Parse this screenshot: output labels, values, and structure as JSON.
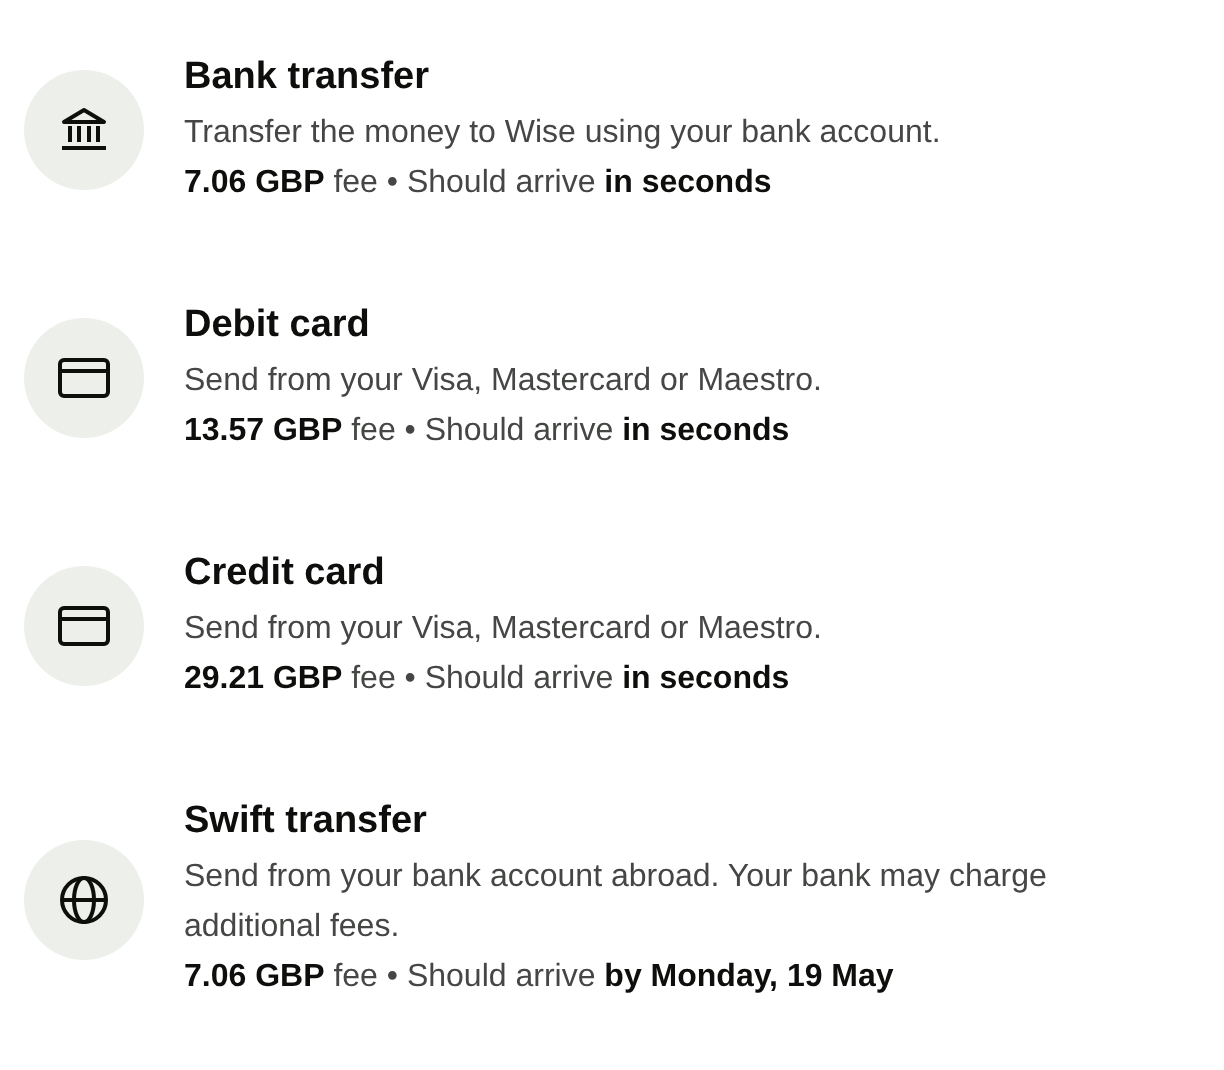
{
  "methods": [
    {
      "kind": "bank",
      "title": "Bank transfer",
      "description": "Transfer the money to Wise using your bank account.",
      "details": "**7.06 GBP** fee • Should arrive **in seconds**"
    },
    {
      "kind": "card",
      "title": "Debit card",
      "description": "Send from your Visa, Mastercard or Maestro.",
      "details": "**13.57 GBP** fee • Should arrive **in seconds**"
    },
    {
      "kind": "card",
      "title": "Credit card",
      "description": "Send from your Visa, Mastercard or Maestro.",
      "details": "**29.21 GBP** fee • Should arrive **in seconds**"
    },
    {
      "kind": "globe",
      "title": "Swift transfer",
      "description": "Send from your bank account abroad. Your bank may charge additional fees.",
      "details": "**7.06 GBP** fee • Should arrive **by Monday, 19 May**"
    }
  ]
}
